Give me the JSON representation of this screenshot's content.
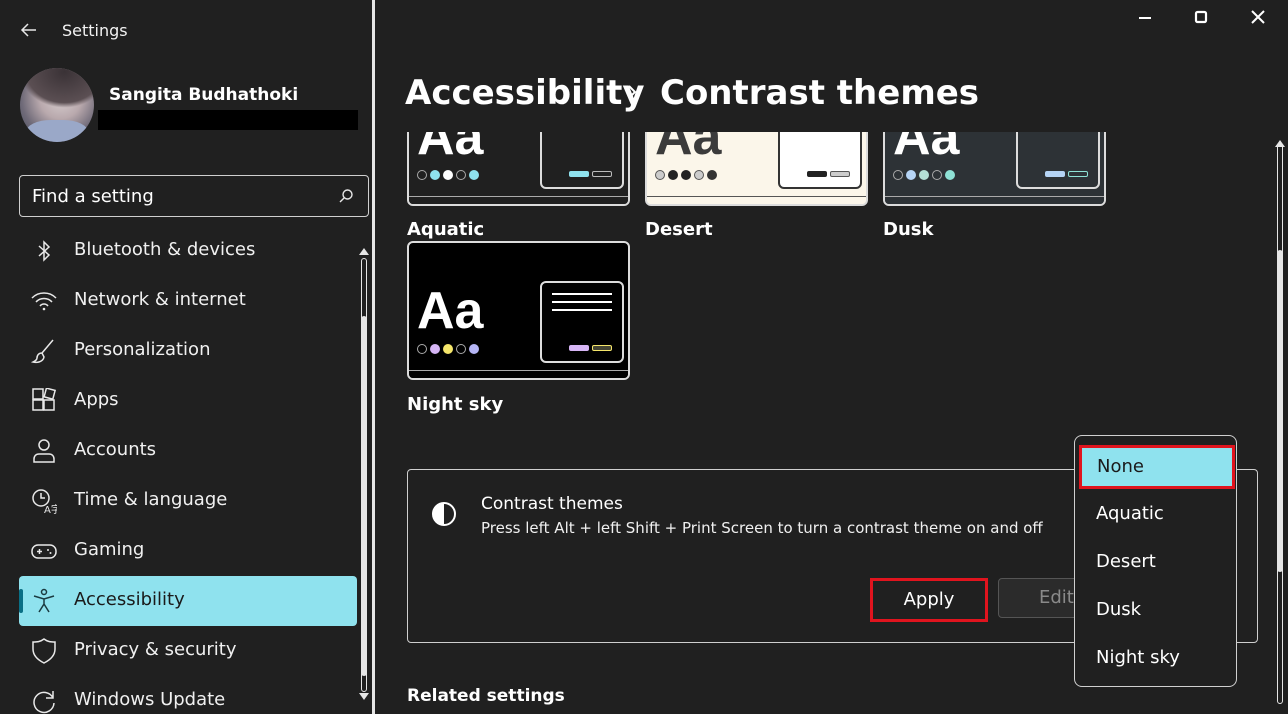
{
  "app": {
    "title": "Settings"
  },
  "user": {
    "name": "Sangita Budhathoki"
  },
  "search": {
    "placeholder": "Find a setting"
  },
  "sidebar": {
    "items": [
      {
        "label": "Bluetooth & devices",
        "icon": "bluetooth-icon"
      },
      {
        "label": "Network & internet",
        "icon": "wifi-icon"
      },
      {
        "label": "Personalization",
        "icon": "brush-icon"
      },
      {
        "label": "Apps",
        "icon": "apps-icon"
      },
      {
        "label": "Accounts",
        "icon": "person-icon"
      },
      {
        "label": "Time & language",
        "icon": "clock-language-icon"
      },
      {
        "label": "Gaming",
        "icon": "gamepad-icon"
      },
      {
        "label": "Accessibility",
        "icon": "accessibility-icon",
        "active": true
      },
      {
        "label": "Privacy & security",
        "icon": "shield-icon"
      },
      {
        "label": "Windows Update",
        "icon": "update-icon"
      }
    ]
  },
  "breadcrumb": {
    "parent": "Accessibility",
    "current": "Contrast themes"
  },
  "themes": [
    {
      "name": "Aquatic",
      "aa": "Aa"
    },
    {
      "name": "Desert",
      "aa": "Aa"
    },
    {
      "name": "Dusk",
      "aa": "Aa"
    },
    {
      "name": "Night sky",
      "aa": "Aa"
    }
  ],
  "contrast_card": {
    "title": "Contrast themes",
    "description": "Press left Alt + left Shift + Print Screen to turn a contrast theme on and off",
    "apply_label": "Apply",
    "edit_label": "Edit"
  },
  "related": {
    "heading": "Related settings"
  },
  "dropdown": {
    "selected": "None",
    "options": [
      "None",
      "Aquatic",
      "Desert",
      "Dusk",
      "Night sky"
    ]
  },
  "colors": {
    "accent": "#8fe2ee",
    "highlight_border": "#e0141e",
    "background": "#202020"
  }
}
